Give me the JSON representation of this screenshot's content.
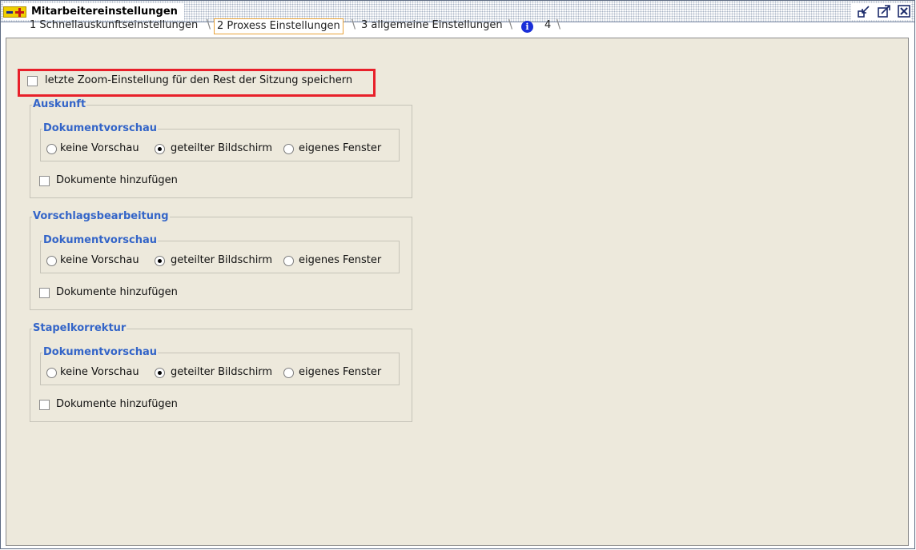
{
  "window": {
    "title": "Mitarbeitereinstellungen"
  },
  "tabs": [
    {
      "label": "1 Schnellauskunftseinstellungen"
    },
    {
      "label": "2 Proxess Einstellungen"
    },
    {
      "label": "3 allgemeine Einstellungen"
    },
    {
      "label": "4"
    }
  ],
  "zoom_checkbox": {
    "label": "letzte Zoom-Einstellung für den Rest der Sitzung speichern",
    "checked": false
  },
  "sections": [
    {
      "title": "Auskunft",
      "subgroup": "Dokumentvorschau",
      "options": [
        "keine Vorschau",
        "geteilter Bildschirm",
        "eigenes Fenster"
      ],
      "selected": "geteilter Bildschirm",
      "checkbox": "Dokumente hinzufügen"
    },
    {
      "title": "Vorschlagsbearbeitung",
      "subgroup": "Dokumentvorschau",
      "options": [
        "keine Vorschau",
        "geteilter Bildschirm",
        "eigenes Fenster"
      ],
      "selected": "geteilter Bildschirm",
      "checkbox": "Dokumente hinzufügen"
    },
    {
      "title": "Stapelkorrektur",
      "subgroup": "Dokumentvorschau",
      "options": [
        "keine Vorschau",
        "geteilter Bildschirm",
        "eigenes Fenster"
      ],
      "selected": "geteilter Bildschirm",
      "checkbox": "Dokumente hinzufügen"
    }
  ],
  "colors": {
    "section_title": "#3465c8",
    "highlight": "#e8202a",
    "panel_bg": "#ede9dc",
    "active_tab_border": "#e8a33a"
  },
  "icons": [
    "app-logo-icon",
    "undock-icon",
    "maximize-icon",
    "close-icon",
    "info-icon"
  ]
}
